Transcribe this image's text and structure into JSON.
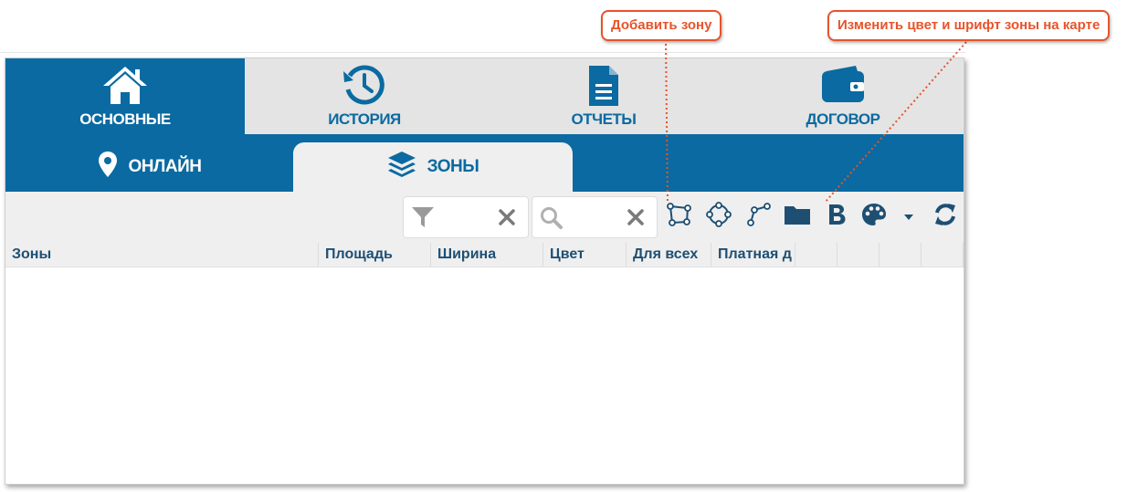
{
  "main_tabs": [
    {
      "label": "ОСНОВНЫЕ",
      "icon": "home-icon",
      "active": true
    },
    {
      "label": "ИСТОРИЯ",
      "icon": "history-icon",
      "active": false
    },
    {
      "label": "ОТЧЕТЫ",
      "icon": "document-icon",
      "active": false
    },
    {
      "label": "ДОГОВОР",
      "icon": "wallet-icon",
      "active": false
    }
  ],
  "sub_tabs": [
    {
      "label": "ОНЛАЙН",
      "icon": "map-marker-icon",
      "active": false
    },
    {
      "label": "ЗОНЫ",
      "icon": "layers-icon",
      "active": true
    }
  ],
  "toolbar": {
    "filter_value": "",
    "search_value": "",
    "tools": [
      "polygon-icon",
      "circle-icon",
      "polyline-icon",
      "folder-icon",
      "bold-icon",
      "palette-icon",
      "caret-down-icon",
      "refresh-icon"
    ]
  },
  "grid": {
    "columns": [
      "Зоны",
      "Площадь",
      "Ширина",
      "Цвет",
      "Для всех",
      "Платная д",
      "",
      "",
      "",
      ""
    ],
    "rows": []
  },
  "callouts": {
    "add_zone": "Добавить зону",
    "change_style": "Изменить цвет и шрифт зоны на карте"
  },
  "colors": {
    "primary": "#0a6aa1",
    "tab_bg": "#e4e4e4",
    "header_text": "#1e4f73",
    "callout": "#e8532a"
  }
}
